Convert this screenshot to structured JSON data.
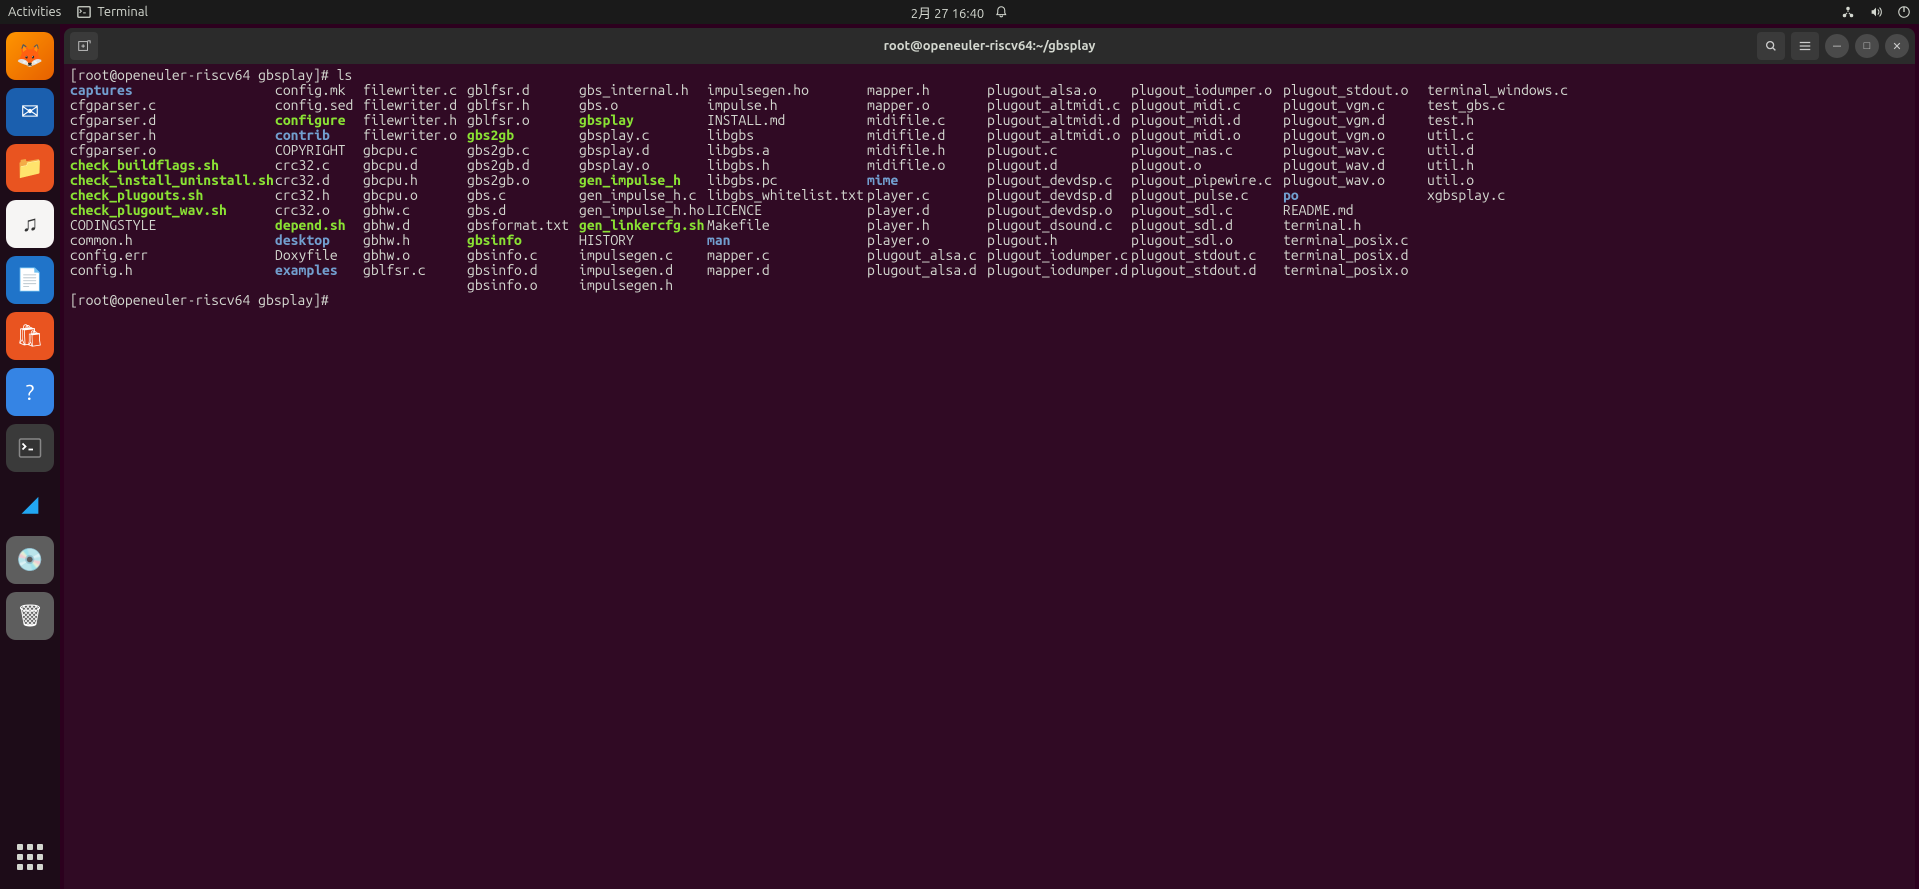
{
  "topbar": {
    "activities": "Activities",
    "app_name": "Terminal",
    "datetime": "2月 27  16:40"
  },
  "window": {
    "title": "root@openeuler-riscv64:~/gbsplay"
  },
  "prompt": {
    "line1_prefix": "[root@openeuler-riscv64 gbsplay]# ",
    "command": "ls",
    "line2": "[root@openeuler-riscv64 gbsplay]# "
  },
  "ls": {
    "columns": [
      [
        {
          "n": "captures",
          "t": "dir"
        },
        {
          "n": "cfgparser.c",
          "t": "f"
        },
        {
          "n": "cfgparser.d",
          "t": "f"
        },
        {
          "n": "cfgparser.h",
          "t": "f"
        },
        {
          "n": "cfgparser.o",
          "t": "f"
        },
        {
          "n": "check_buildflags.sh",
          "t": "exec"
        },
        {
          "n": "check_install_uninstall.sh",
          "t": "exec"
        },
        {
          "n": "check_plugouts.sh",
          "t": "exec"
        },
        {
          "n": "check_plugout_wav.sh",
          "t": "exec"
        },
        {
          "n": "CODINGSTYLE",
          "t": "f"
        },
        {
          "n": "common.h",
          "t": "f"
        },
        {
          "n": "config.err",
          "t": "f"
        },
        {
          "n": "config.h",
          "t": "f"
        }
      ],
      [
        {
          "n": "config.mk",
          "t": "f"
        },
        {
          "n": "config.sed",
          "t": "f"
        },
        {
          "n": "configure",
          "t": "exec"
        },
        {
          "n": "contrib",
          "t": "dir"
        },
        {
          "n": "COPYRIGHT",
          "t": "f"
        },
        {
          "n": "crc32.c",
          "t": "f"
        },
        {
          "n": "crc32.d",
          "t": "f"
        },
        {
          "n": "crc32.h",
          "t": "f"
        },
        {
          "n": "crc32.o",
          "t": "f"
        },
        {
          "n": "depend.sh",
          "t": "exec"
        },
        {
          "n": "desktop",
          "t": "dir"
        },
        {
          "n": "Doxyfile",
          "t": "f"
        },
        {
          "n": "examples",
          "t": "dir"
        }
      ],
      [
        {
          "n": "filewriter.c",
          "t": "f"
        },
        {
          "n": "filewriter.d",
          "t": "f"
        },
        {
          "n": "filewriter.h",
          "t": "f"
        },
        {
          "n": "filewriter.o",
          "t": "f"
        },
        {
          "n": "gbcpu.c",
          "t": "f"
        },
        {
          "n": "gbcpu.d",
          "t": "f"
        },
        {
          "n": "gbcpu.h",
          "t": "f"
        },
        {
          "n": "gbcpu.o",
          "t": "f"
        },
        {
          "n": "gbhw.c",
          "t": "f"
        },
        {
          "n": "gbhw.d",
          "t": "f"
        },
        {
          "n": "gbhw.h",
          "t": "f"
        },
        {
          "n": "gbhw.o",
          "t": "f"
        },
        {
          "n": "gblfsr.c",
          "t": "f"
        }
      ],
      [
        {
          "n": "gblfsr.d",
          "t": "f"
        },
        {
          "n": "gblfsr.h",
          "t": "f"
        },
        {
          "n": "gblfsr.o",
          "t": "f"
        },
        {
          "n": "gbs2gb",
          "t": "exec"
        },
        {
          "n": "gbs2gb.c",
          "t": "f"
        },
        {
          "n": "gbs2gb.d",
          "t": "f"
        },
        {
          "n": "gbs2gb.o",
          "t": "f"
        },
        {
          "n": "gbs.c",
          "t": "f"
        },
        {
          "n": "gbs.d",
          "t": "f"
        },
        {
          "n": "gbsformat.txt",
          "t": "f"
        },
        {
          "n": "gbsinfo",
          "t": "exec"
        },
        {
          "n": "gbsinfo.c",
          "t": "f"
        },
        {
          "n": "gbsinfo.d",
          "t": "f"
        },
        {
          "n": "gbsinfo.o",
          "t": "f"
        }
      ],
      [
        {
          "n": "gbs_internal.h",
          "t": "f"
        },
        {
          "n": "gbs.o",
          "t": "f"
        },
        {
          "n": "gbsplay",
          "t": "exec"
        },
        {
          "n": "gbsplay.c",
          "t": "f"
        },
        {
          "n": "gbsplay.d",
          "t": "f"
        },
        {
          "n": "gbsplay.o",
          "t": "f"
        },
        {
          "n": "gen_impulse_h",
          "t": "exec"
        },
        {
          "n": "gen_impulse_h.c",
          "t": "f"
        },
        {
          "n": "gen_impulse_h.ho",
          "t": "f"
        },
        {
          "n": "gen_linkercfg.sh",
          "t": "exec"
        },
        {
          "n": "HISTORY",
          "t": "f"
        },
        {
          "n": "impulsegen.c",
          "t": "f"
        },
        {
          "n": "impulsegen.d",
          "t": "f"
        },
        {
          "n": "impulsegen.h",
          "t": "f"
        }
      ],
      [
        {
          "n": "impulsegen.ho",
          "t": "f"
        },
        {
          "n": "impulse.h",
          "t": "f"
        },
        {
          "n": "INSTALL.md",
          "t": "f"
        },
        {
          "n": "libgbs",
          "t": "f"
        },
        {
          "n": "libgbs.a",
          "t": "f"
        },
        {
          "n": "libgbs.h",
          "t": "f"
        },
        {
          "n": "libgbs.pc",
          "t": "f"
        },
        {
          "n": "libgbs_whitelist.txt",
          "t": "f"
        },
        {
          "n": "LICENCE",
          "t": "f"
        },
        {
          "n": "Makefile",
          "t": "f"
        },
        {
          "n": "man",
          "t": "dir"
        },
        {
          "n": "mapper.c",
          "t": "f"
        },
        {
          "n": "mapper.d",
          "t": "f"
        }
      ],
      [
        {
          "n": "mapper.h",
          "t": "f"
        },
        {
          "n": "mapper.o",
          "t": "f"
        },
        {
          "n": "midifile.c",
          "t": "f"
        },
        {
          "n": "midifile.d",
          "t": "f"
        },
        {
          "n": "midifile.h",
          "t": "f"
        },
        {
          "n": "midifile.o",
          "t": "f"
        },
        {
          "n": "mime",
          "t": "dir"
        },
        {
          "n": "player.c",
          "t": "f"
        },
        {
          "n": "player.d",
          "t": "f"
        },
        {
          "n": "player.h",
          "t": "f"
        },
        {
          "n": "player.o",
          "t": "f"
        },
        {
          "n": "plugout_alsa.c",
          "t": "f"
        },
        {
          "n": "plugout_alsa.d",
          "t": "f"
        }
      ],
      [
        {
          "n": "plugout_alsa.o",
          "t": "f"
        },
        {
          "n": "plugout_altmidi.c",
          "t": "f"
        },
        {
          "n": "plugout_altmidi.d",
          "t": "f"
        },
        {
          "n": "plugout_altmidi.o",
          "t": "f"
        },
        {
          "n": "plugout.c",
          "t": "f"
        },
        {
          "n": "plugout.d",
          "t": "f"
        },
        {
          "n": "plugout_devdsp.c",
          "t": "f"
        },
        {
          "n": "plugout_devdsp.d",
          "t": "f"
        },
        {
          "n": "plugout_devdsp.o",
          "t": "f"
        },
        {
          "n": "plugout_dsound.c",
          "t": "f"
        },
        {
          "n": "plugout.h",
          "t": "f"
        },
        {
          "n": "plugout_iodumper.c",
          "t": "f"
        },
        {
          "n": "plugout_iodumper.d",
          "t": "f"
        }
      ],
      [
        {
          "n": "plugout_iodumper.o",
          "t": "f"
        },
        {
          "n": "plugout_midi.c",
          "t": "f"
        },
        {
          "n": "plugout_midi.d",
          "t": "f"
        },
        {
          "n": "plugout_midi.o",
          "t": "f"
        },
        {
          "n": "plugout_nas.c",
          "t": "f"
        },
        {
          "n": "plugout.o",
          "t": "f"
        },
        {
          "n": "plugout_pipewire.c",
          "t": "f"
        },
        {
          "n": "plugout_pulse.c",
          "t": "f"
        },
        {
          "n": "plugout_sdl.c",
          "t": "f"
        },
        {
          "n": "plugout_sdl.d",
          "t": "f"
        },
        {
          "n": "plugout_sdl.o",
          "t": "f"
        },
        {
          "n": "plugout_stdout.c",
          "t": "f"
        },
        {
          "n": "plugout_stdout.d",
          "t": "f"
        }
      ],
      [
        {
          "n": "plugout_stdout.o",
          "t": "f"
        },
        {
          "n": "plugout_vgm.c",
          "t": "f"
        },
        {
          "n": "plugout_vgm.d",
          "t": "f"
        },
        {
          "n": "plugout_vgm.o",
          "t": "f"
        },
        {
          "n": "plugout_wav.c",
          "t": "f"
        },
        {
          "n": "plugout_wav.d",
          "t": "f"
        },
        {
          "n": "plugout_wav.o",
          "t": "f"
        },
        {
          "n": "po",
          "t": "dir"
        },
        {
          "n": "README.md",
          "t": "f"
        },
        {
          "n": "terminal.h",
          "t": "f"
        },
        {
          "n": "terminal_posix.c",
          "t": "f"
        },
        {
          "n": "terminal_posix.d",
          "t": "f"
        },
        {
          "n": "terminal_posix.o",
          "t": "f"
        }
      ],
      [
        {
          "n": "terminal_windows.c",
          "t": "f"
        },
        {
          "n": "test_gbs.c",
          "t": "f"
        },
        {
          "n": "test.h",
          "t": "f"
        },
        {
          "n": "util.c",
          "t": "f"
        },
        {
          "n": "util.d",
          "t": "f"
        },
        {
          "n": "util.h",
          "t": "f"
        },
        {
          "n": "util.o",
          "t": "f"
        },
        {
          "n": "xgbsplay.c",
          "t": "f"
        }
      ]
    ]
  }
}
